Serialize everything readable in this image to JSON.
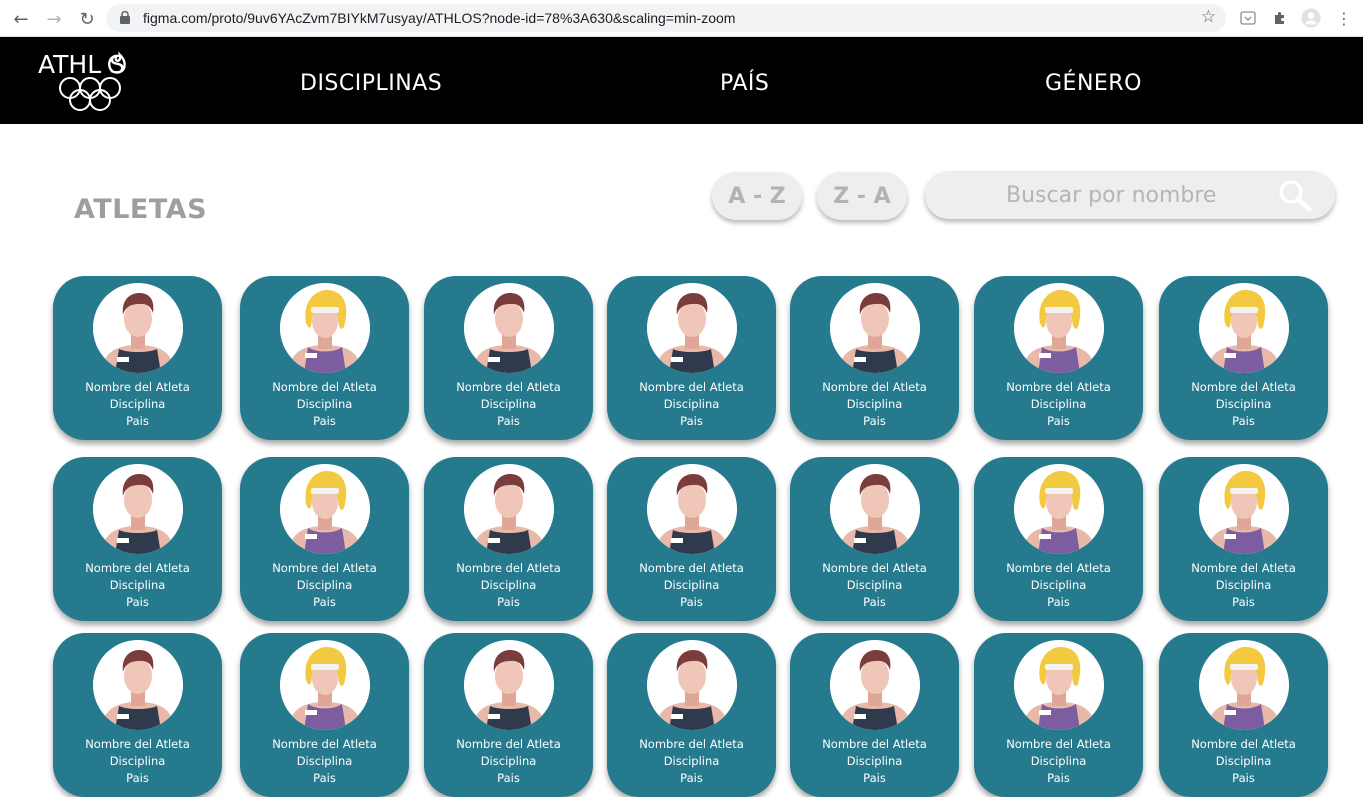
{
  "browser": {
    "url": "figma.com/proto/9uv6YAcZvm7BIYkM7usyay/ATHLOS?node-id=78%3A630&scaling=min-zoom"
  },
  "header": {
    "logo_text": "ATHL S",
    "nav": [
      "DISCIPLINAS",
      "PAÍS",
      "GÉNERO"
    ]
  },
  "page": {
    "title": "ATLETAS",
    "sort_az": "A - Z",
    "sort_za": "Z - A",
    "search_placeholder": "Buscar por nombre"
  },
  "card_labels": {
    "name": "Nombre del Atleta",
    "discipline": "Disciplina",
    "country": "Pais"
  },
  "athletes": {
    "rows": [
      [
        "male",
        "female",
        "male",
        "male",
        "male",
        "female",
        "female"
      ],
      [
        "male",
        "female",
        "male",
        "male",
        "male",
        "female",
        "female"
      ],
      [
        "male",
        "female",
        "male",
        "male",
        "male",
        "female",
        "female"
      ]
    ]
  },
  "colors": {
    "card": "#267a8e",
    "header_bg": "#000000",
    "muted_text": "#9e9e9e"
  }
}
